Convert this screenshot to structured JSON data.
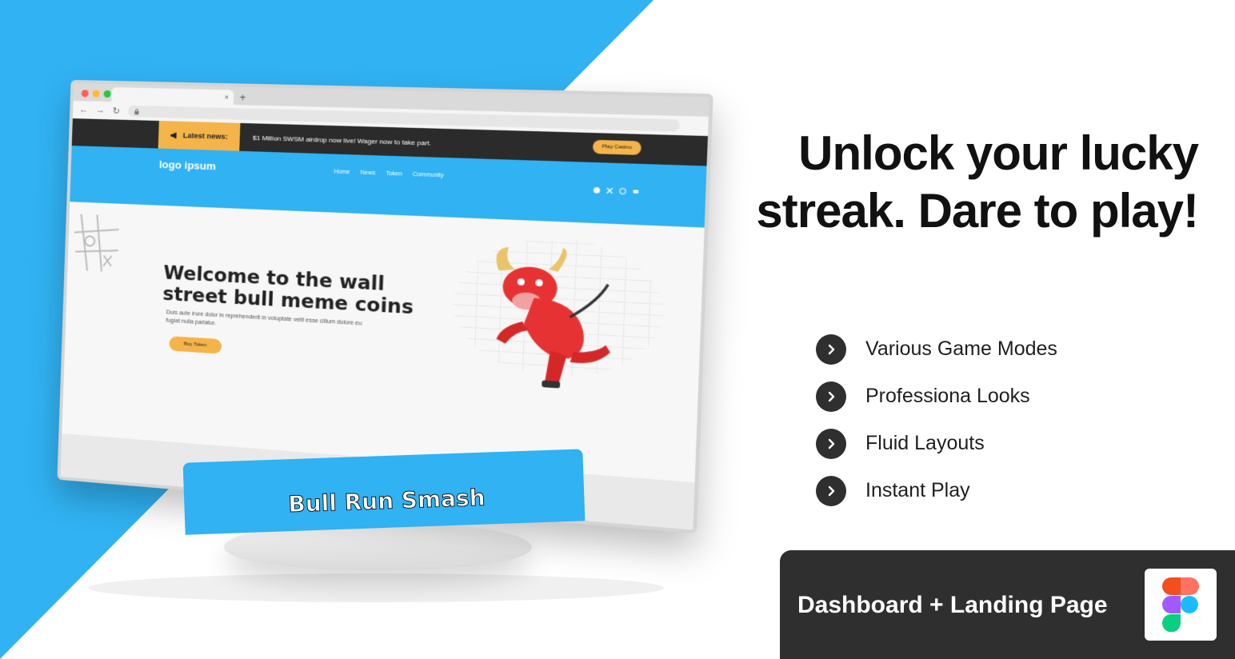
{
  "colors": {
    "accent_blue": "#30b2f3",
    "dark": "#2f2f2f",
    "gold": "#f5b44a"
  },
  "browser": {
    "close_glyph": "×",
    "plus_glyph": "+",
    "back_glyph": "←",
    "forward_glyph": "→",
    "reload_glyph": "↻"
  },
  "site": {
    "news_label": "Latest news:",
    "news_text": "$1 Million SWSM airdrop now live! Wager now to take part.",
    "logo_text": "logo ipsum",
    "nav": [
      "Home",
      "News",
      "Token",
      "Community"
    ],
    "play_button": "Play Casino",
    "hero_title": "Welcome  to the wall street bull meme coins",
    "hero_subtitle": "Duis aute irure dolor in reprehenderit in voluptate velit esse cillum dolore eu fugiat nulla pariatur.",
    "hero_button": "Buy Token",
    "banner_title": "Bull Run Smash"
  },
  "headline": "Unlock your lucky streak. Dare to play!",
  "features": [
    {
      "label": "Various Game Modes",
      "icon": "chevron-right-icon"
    },
    {
      "label": "Professiona Looks",
      "icon": "chevron-right-icon"
    },
    {
      "label": "Fluid Layouts",
      "icon": "chevron-right-icon"
    },
    {
      "label": "Instant Play",
      "icon": "chevron-right-icon"
    }
  ],
  "badge": {
    "text": "Dashboard + Landing Page",
    "icon": "figma-icon"
  }
}
